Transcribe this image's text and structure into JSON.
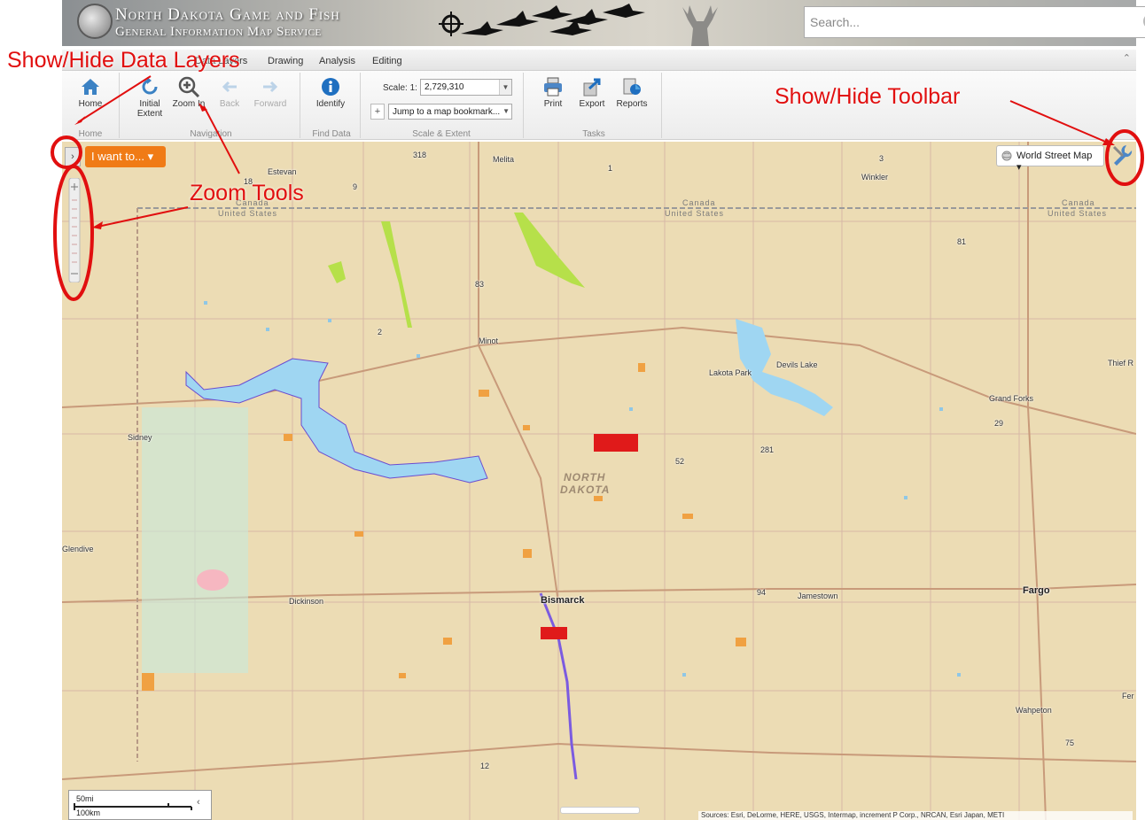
{
  "header": {
    "title_line1": "North Dakota Game and Fish",
    "title_line2": "General Information Map Service",
    "search_placeholder": "Search...",
    "help_label": "?"
  },
  "tabs": [
    {
      "label": "Data Layers"
    },
    {
      "label": "Drawing"
    },
    {
      "label": "Analysis"
    },
    {
      "label": "Editing"
    }
  ],
  "ribbon": {
    "home": {
      "button": "Home",
      "group": "Home"
    },
    "navigation": {
      "initial_extent": "Initial Extent",
      "zoom_in": "Zoom In",
      "back": "Back",
      "forward": "Forward",
      "group": "Navigation"
    },
    "find_data": {
      "identify": "Identify",
      "group": "Find Data"
    },
    "scale_extent": {
      "scale_label": "Scale: 1:",
      "scale_value": "2,729,310",
      "bookmark_placeholder": "Jump to a map bookmark...",
      "group": "Scale & Extent"
    },
    "tasks": {
      "print": "Print",
      "export": "Export",
      "reports": "Reports",
      "group": "Tasks"
    }
  },
  "map_controls": {
    "panel_toggle": "›",
    "i_want_to": "I want to... ▾",
    "basemap": "World Street Map ▾",
    "scalebar_mi": "50mi",
    "scalebar_km": "100km",
    "attribution": "Sources: Esri, DeLorme, HERE, USGS, Intermap, increment P Corp., NRCAN, Esri Japan, METI"
  },
  "map_labels": {
    "cities": [
      "Estevan",
      "Melita",
      "Winkler",
      "Minot",
      "Devils Lake",
      "Lakota Park",
      "Grand Forks",
      "Thief R",
      "Sidney",
      "Glendive",
      "Dickinson",
      "Bismarck",
      "Jamestown",
      "Fargo",
      "Wahpeton",
      "Fer"
    ],
    "state": [
      "NORTH",
      "DAKOTA"
    ],
    "canada": "Canada",
    "united_states": "United States",
    "highways": [
      "318",
      "18",
      "9",
      "3",
      "81",
      "83",
      "2",
      "52",
      "281",
      "29",
      "94",
      "12",
      "75",
      "1"
    ]
  },
  "annotations": {
    "data_layers": "Show/Hide Data Layers",
    "toolbar": "Show/Hide Toolbar",
    "zoom_tools": "Zoom Tools"
  },
  "colors": {
    "accent_orange": "#f07b16",
    "annotation_red": "#e10f0f",
    "water_blue": "#9fd6f2",
    "map_background": "#ecdcb4"
  }
}
